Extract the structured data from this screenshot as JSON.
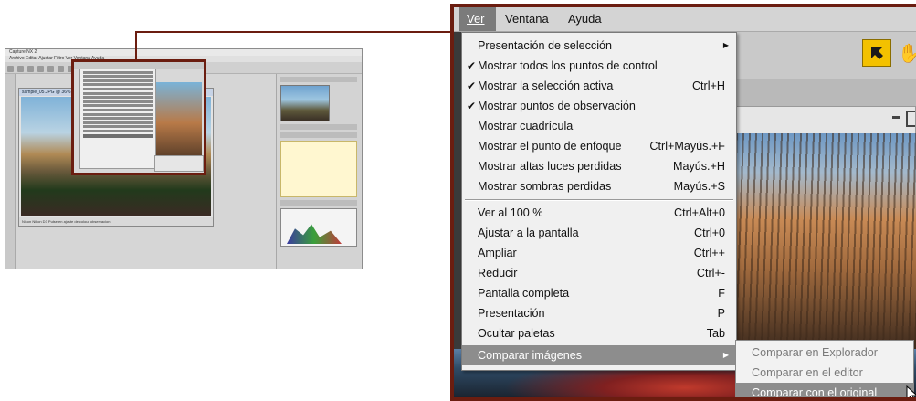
{
  "menubar": {
    "ver": "Ver",
    "ventana": "Ventana",
    "ayuda": "Ayuda"
  },
  "menu": {
    "items": [
      {
        "label": "Presentación de selección",
        "shortcut": "",
        "checked": false,
        "submenu": true
      },
      {
        "label": "Mostrar todos los puntos de control",
        "shortcut": "",
        "checked": true
      },
      {
        "label": "Mostrar la selección activa",
        "shortcut": "Ctrl+H",
        "checked": true
      },
      {
        "label": "Mostrar puntos de observación",
        "shortcut": "",
        "checked": true
      },
      {
        "label": "Mostrar cuadrícula",
        "shortcut": "",
        "checked": false
      },
      {
        "label": "Mostrar el punto de enfoque",
        "shortcut": "Ctrl+Mayús.+F",
        "checked": false
      },
      {
        "label": "Mostrar altas luces perdidas",
        "shortcut": "Mayús.+H",
        "checked": false
      },
      {
        "label": "Mostrar sombras perdidas",
        "shortcut": "Mayús.+S",
        "checked": false
      },
      {
        "label": "Ver al 100 %",
        "shortcut": "Ctrl+Alt+0",
        "checked": false
      },
      {
        "label": "Ajustar a la pantalla",
        "shortcut": "Ctrl+0",
        "checked": false
      },
      {
        "label": "Ampliar",
        "shortcut": "Ctrl++",
        "checked": false
      },
      {
        "label": "Reducir",
        "shortcut": "Ctrl+-",
        "checked": false
      },
      {
        "label": "Pantalla completa",
        "shortcut": "F",
        "checked": false
      },
      {
        "label": "Presentación",
        "shortcut": "P",
        "checked": false
      },
      {
        "label": "Ocultar paletas",
        "shortcut": "Tab",
        "checked": false
      },
      {
        "label": "Comparar imágenes",
        "shortcut": "",
        "checked": false,
        "submenu": true,
        "highlighted": true
      }
    ],
    "check_mark": "✔"
  },
  "submenu": {
    "items": [
      {
        "label": "Comparar en Explorador",
        "enabled": false
      },
      {
        "label": "Comparar en el editor",
        "enabled": false
      },
      {
        "label": "Comparar con el original",
        "enabled": true,
        "highlighted": true
      }
    ]
  },
  "thumbnail": {
    "title": "Capture NX 2",
    "menubar": "Archivo  Editar  Ajustar  Filtro  Ver  Ventana  Ayuda",
    "doc_title": "sample_05.JPG @ 36%",
    "status": "Nikon Nikon D3  Pulse en ajuste de colour observacion"
  },
  "colors": {
    "accent_frame": "#6b1d10",
    "highlight": "#8d8d8d",
    "arrow_button": "#f3c100"
  },
  "icons": [
    "arrow-cursor-icon",
    "hand-tool-icon",
    "submenu-arrow-icon",
    "mouse-pointer-icon"
  ]
}
